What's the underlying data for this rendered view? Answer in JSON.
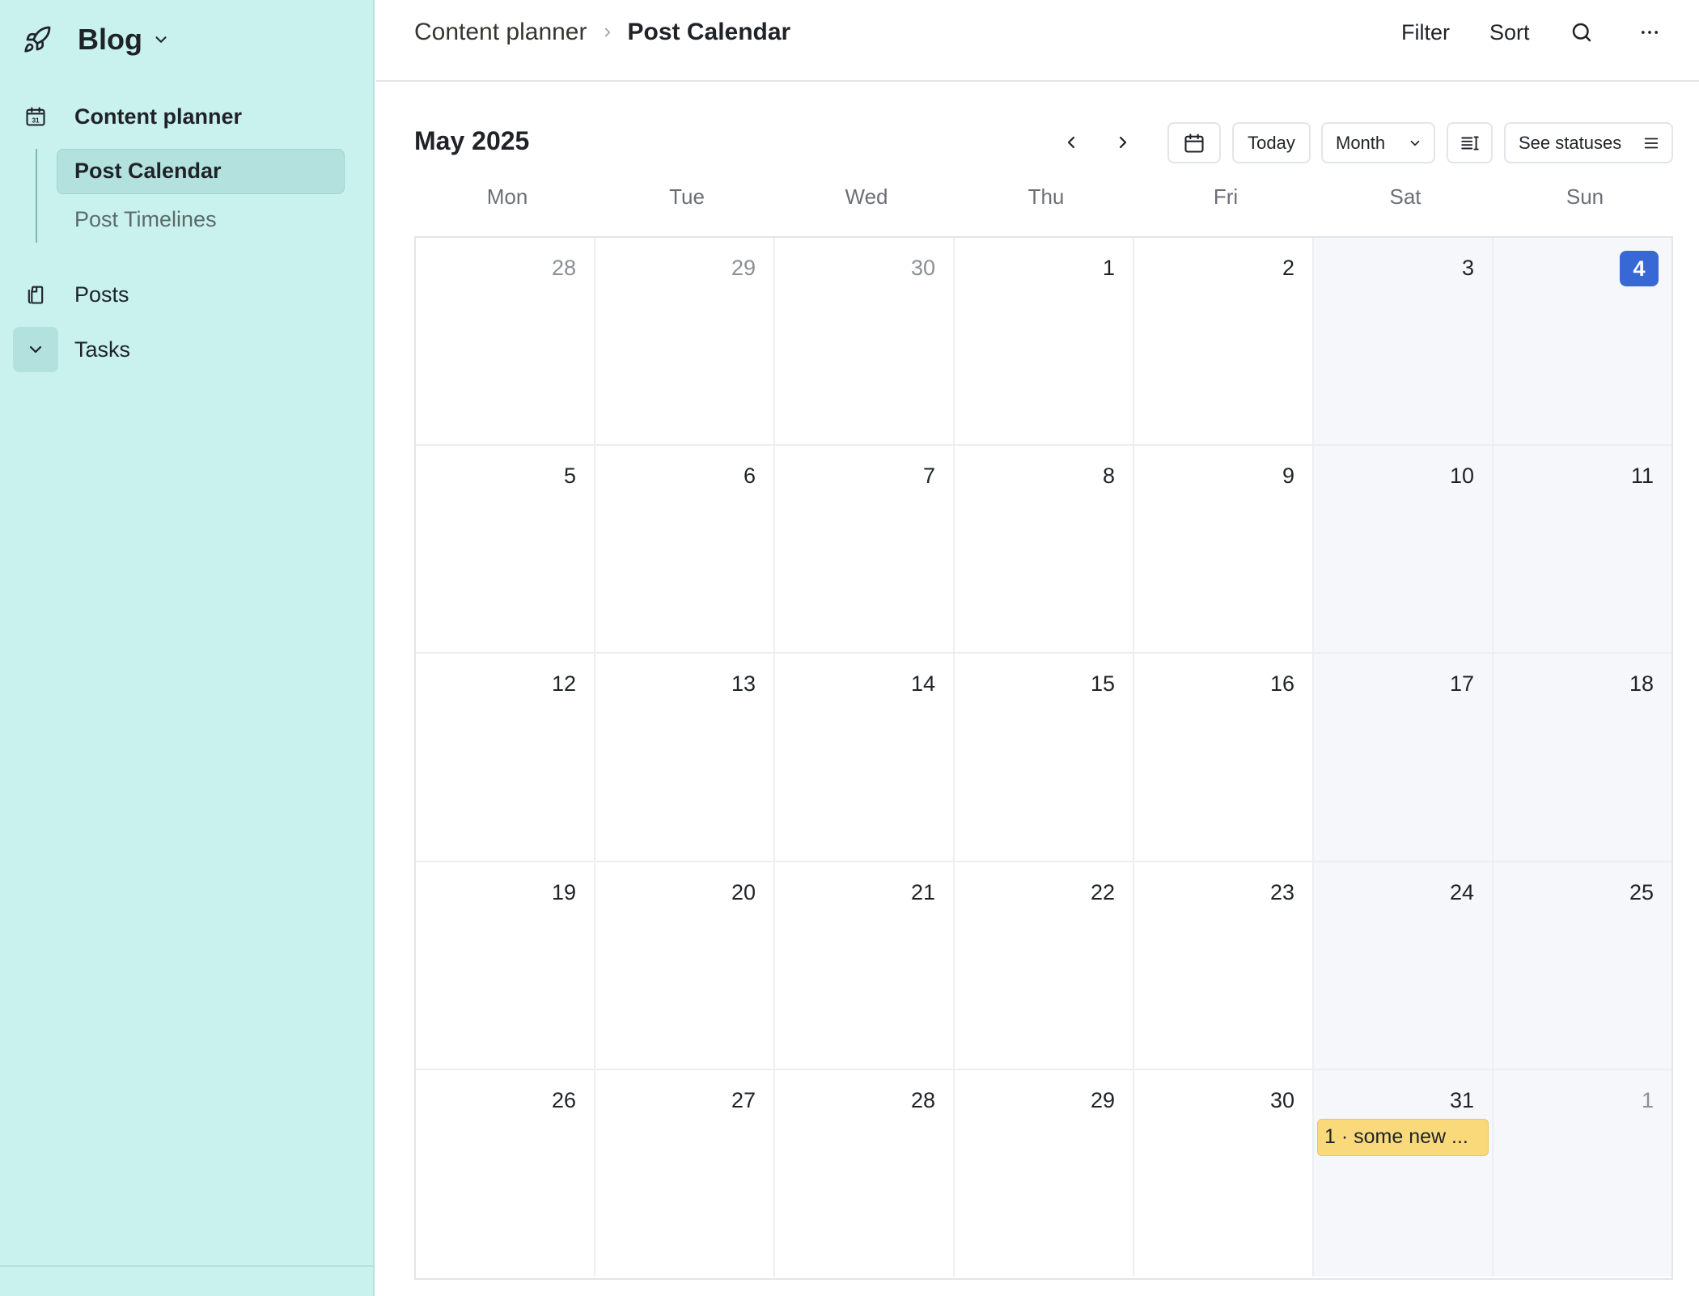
{
  "sidebar": {
    "workspace_name": "Blog",
    "workspace_icon": "rocket-icon",
    "items": [
      {
        "label": "Content planner",
        "icon": "calendar-icon"
      },
      {
        "label": "Posts",
        "icon": "documents-icon"
      },
      {
        "label": "Tasks",
        "icon": "chevron-down-icon"
      }
    ],
    "subitems": [
      {
        "label": "Post Calendar"
      },
      {
        "label": "Post Timelines"
      }
    ]
  },
  "header": {
    "breadcrumb_parent": "Content planner",
    "breadcrumb_current": "Post Calendar",
    "filter_label": "Filter",
    "sort_label": "Sort"
  },
  "toolbar": {
    "month_title": "May 2025",
    "today_label": "Today",
    "view_label": "Month",
    "statuses_label": "See statuses"
  },
  "calendar": {
    "weekdays": [
      "Mon",
      "Tue",
      "Wed",
      "Thu",
      "Fri",
      "Sat",
      "Sun"
    ],
    "weeks": [
      [
        "28",
        "29",
        "30",
        "1",
        "2",
        "3",
        "4"
      ],
      [
        "5",
        "6",
        "7",
        "8",
        "9",
        "10",
        "11"
      ],
      [
        "12",
        "13",
        "14",
        "15",
        "16",
        "17",
        "18"
      ],
      [
        "19",
        "20",
        "21",
        "22",
        "23",
        "24",
        "25"
      ],
      [
        "26",
        "27",
        "28",
        "29",
        "30",
        "31",
        "1"
      ]
    ],
    "today": "4",
    "event": {
      "date": "31",
      "label": "1 · some new ..."
    }
  },
  "colors": {
    "sidebar_bg": "#c9f1ee",
    "today_badge": "#3867d6",
    "event_bg": "#f9d97a",
    "weekend_bg": "#f5f7fa"
  }
}
